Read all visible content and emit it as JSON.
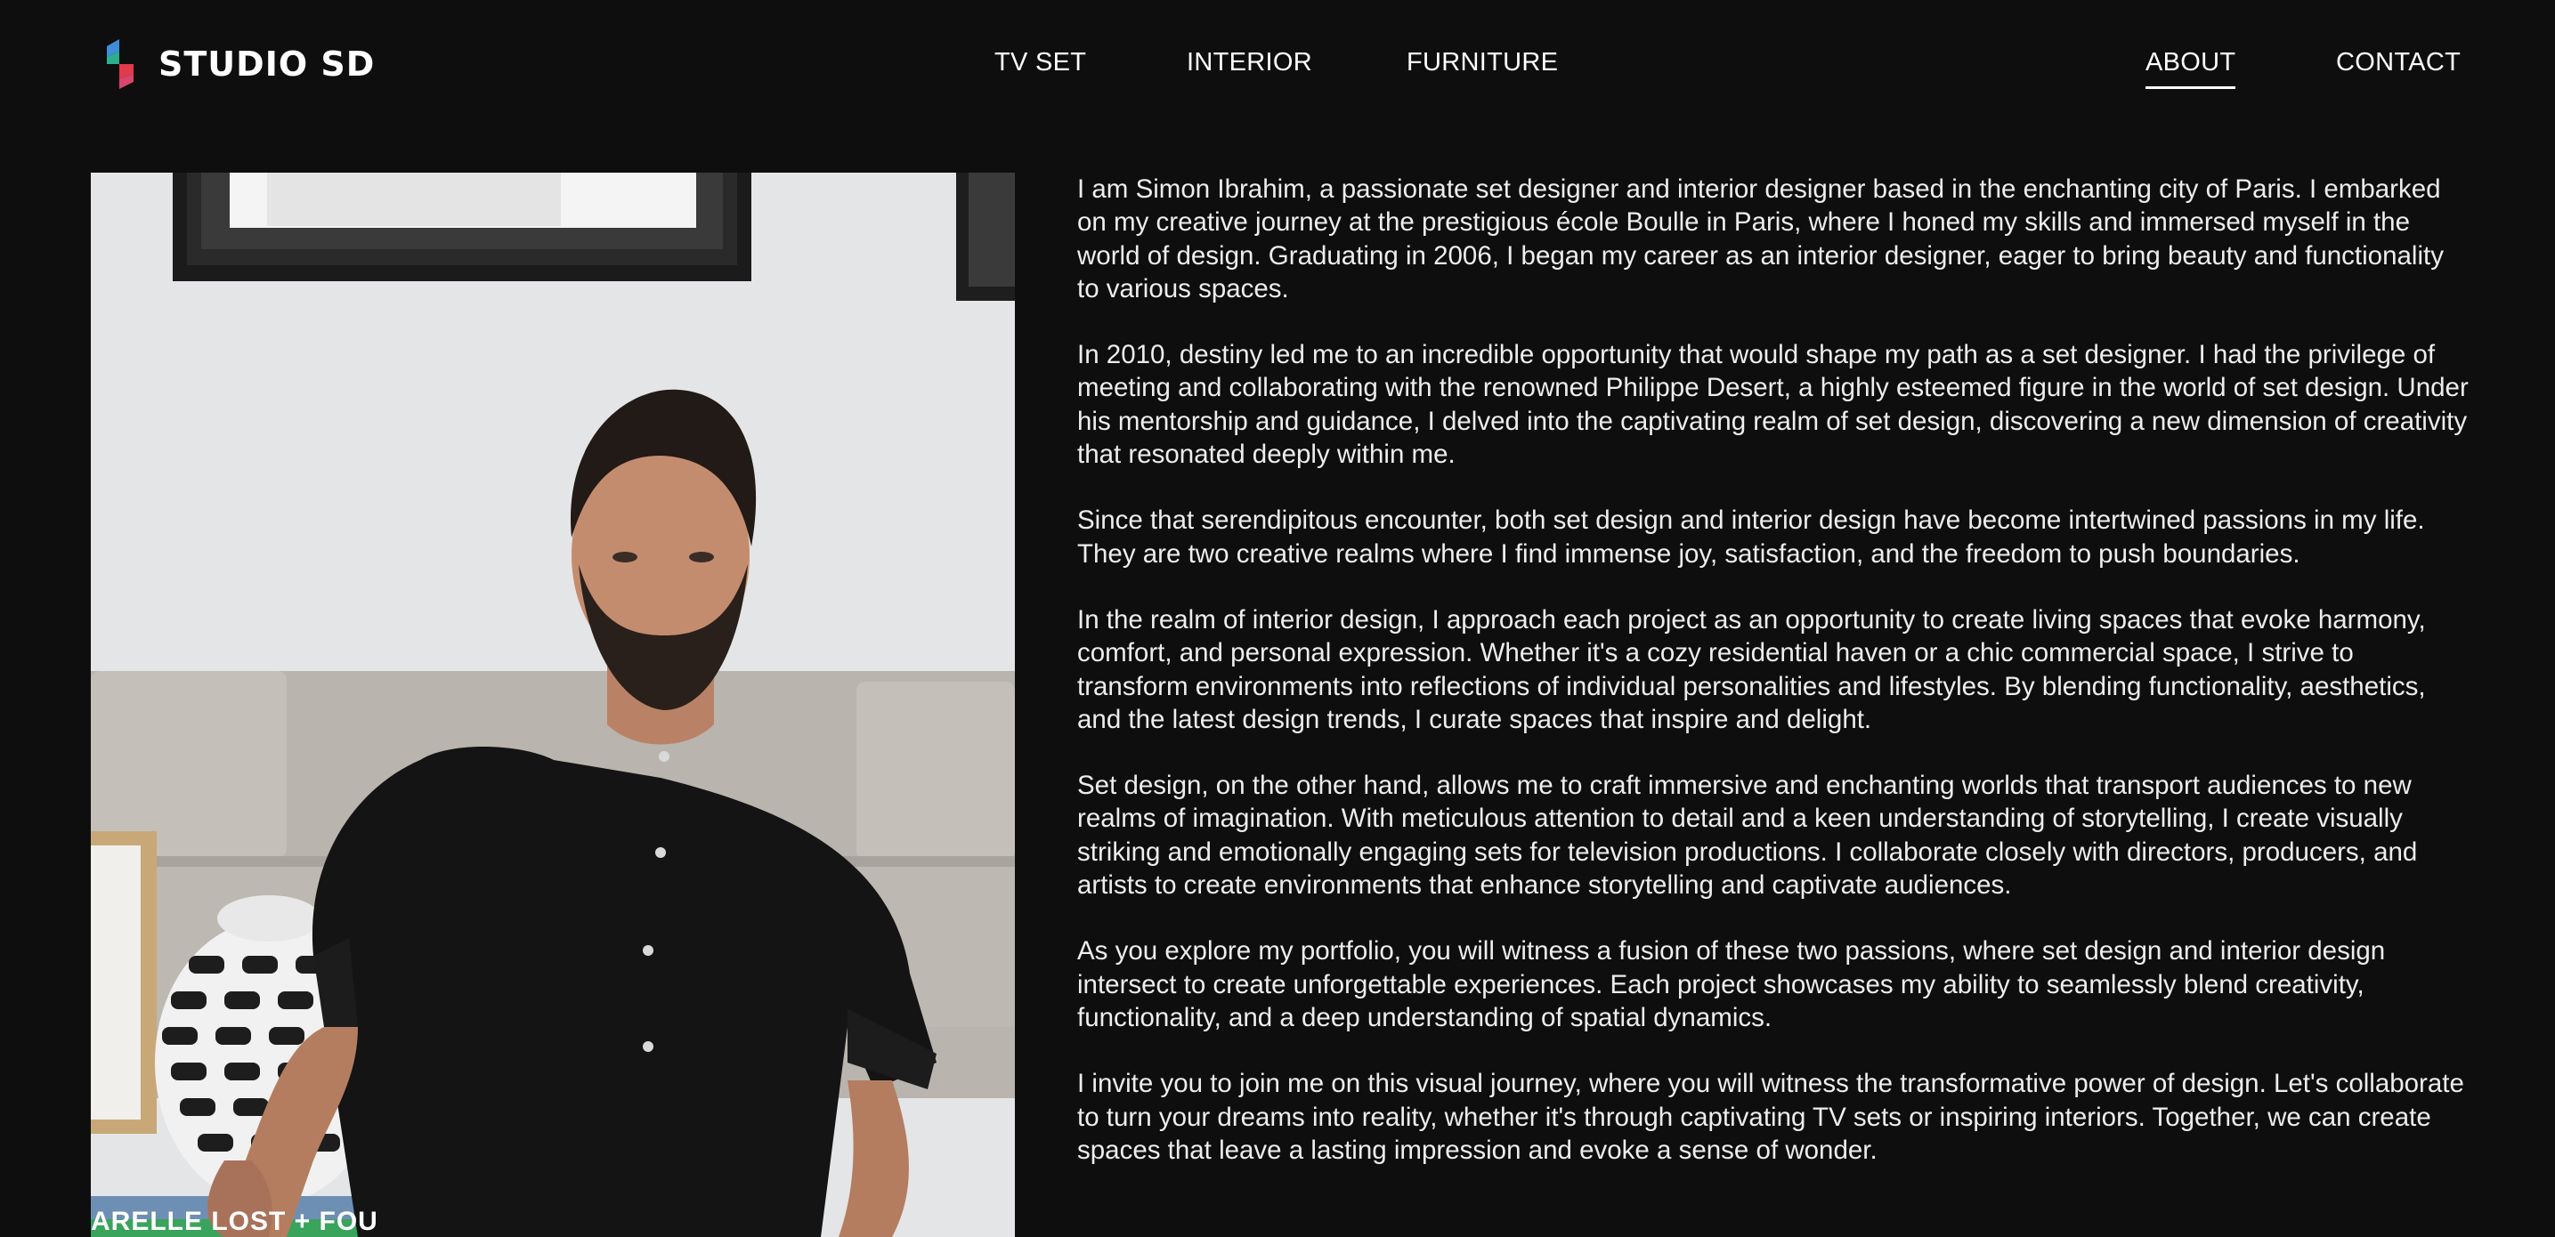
{
  "brand": {
    "name": "STUDIO SD",
    "logo_icon": "studio-sd-logo",
    "colors": {
      "blue": "#3f8fd8",
      "green": "#2cae8c",
      "red": "#e03a4c",
      "pink": "#d8466e"
    }
  },
  "nav": {
    "items": [
      {
        "label": "TV SET",
        "active": false
      },
      {
        "label": "INTERIOR",
        "active": false
      },
      {
        "label": "FURNITURE",
        "active": false
      },
      {
        "label": "ABOUT",
        "active": true
      },
      {
        "label": "CONTACT",
        "active": false
      }
    ]
  },
  "photo": {
    "subject": "portrait-photo",
    "book_spine_text": "ARELLE LOST + FOU"
  },
  "bio": {
    "paragraphs": [
      "I am Simon Ibrahim, a passionate set designer and interior designer based in the enchanting city of Paris. I embarked on my creative journey at the prestigious école Boulle in Paris, where I honed my skills and immersed myself in the world of design. Graduating in 2006, I began my career as an interior designer, eager to bring beauty and functionality to various spaces.",
      "In 2010, destiny led me to an incredible opportunity that would shape my path as a set designer. I had the privilege of meeting and collaborating with the renowned Philippe Desert, a highly esteemed figure in the world of set design. Under his mentorship and guidance, I delved into the captivating realm of set design, discovering a new dimension of creativity that resonated deeply within me.",
      "Since that serendipitous encounter, both set design and interior design have become intertwined passions in my life. They are two creative realms where I find immense joy, satisfaction, and the freedom to push boundaries.",
      "In the realm of interior design, I approach each project as an opportunity to create living spaces that evoke harmony, comfort, and personal expression. Whether it's a cozy residential haven or a chic commercial space, I strive to transform environments into reflections of individual personalities and lifestyles. By blending functionality, aesthetics, and the latest design trends, I curate spaces that inspire and delight.",
      "Set design, on the other hand, allows me to craft immersive and enchanting worlds that transport audiences to new realms of imagination. With meticulous attention to detail and a keen understanding of storytelling, I create visually striking and emotionally engaging sets for television productions. I collaborate closely with directors, producers, and artists to create environments that enhance storytelling and captivate audiences.",
      "As you explore my portfolio, you will witness a fusion of these two passions, where set design and interior design intersect to create unforgettable experiences. Each project showcases my ability to seamlessly blend creativity, functionality, and a deep understanding of spatial dynamics.",
      "I invite you to join me on this visual journey, where you will witness the transformative power of design. Let's collaborate to turn your dreams into reality, whether it's through captivating TV sets or inspiring interiors. Together, we can create spaces that leave a lasting impression and evoke a sense of wonder."
    ]
  }
}
